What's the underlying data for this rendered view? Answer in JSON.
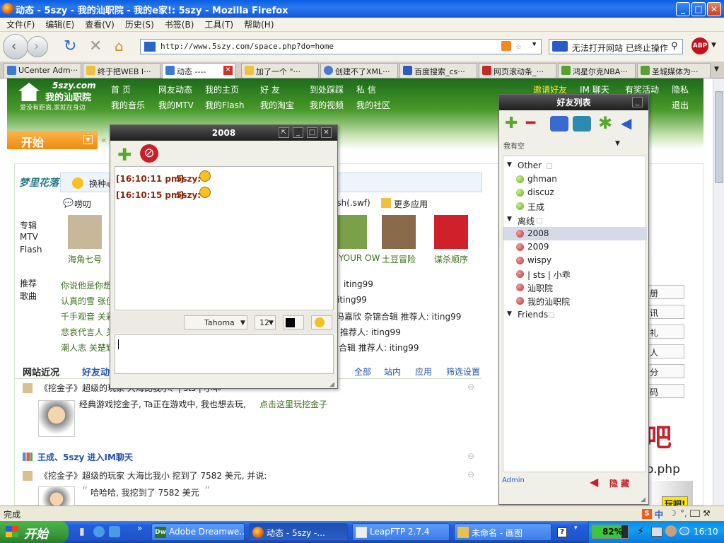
{
  "window": {
    "title": "动态 - 5szy - 我的汕职院 - 我的e家!: 5szy - Mozilla Firefox"
  },
  "menu": [
    "文件(F)",
    "编辑(E)",
    "查看(V)",
    "历史(S)",
    "书签(B)",
    "工具(T)",
    "帮助(H)"
  ],
  "address": {
    "url": "http://www.5szy.com/space.php?do=home"
  },
  "search": {
    "value": "无法打开网站 已终止操作"
  },
  "tabs": [
    "UCenter Adm···",
    "终于把WEB I···",
    "动态 ----",
    "加了一个 \"···",
    "创建不了XML···",
    "百度搜索_cs···",
    "网页滚动条_···",
    "鸿星尔克NBA···",
    "圣城媒体为···"
  ],
  "site": {
    "logo_top": "5szy.com",
    "logo_name": "我的汕职院",
    "logo_slogan": "爱没有距离,家就在身边",
    "nav_row1": [
      "首  页",
      "网友动态",
      "我的主页",
      "好  友",
      "到处踩踩",
      "私  信"
    ],
    "nav_row2": [
      "我的音乐",
      "我的MTV",
      "我的Flash",
      "我的淘宝",
      "我的视频",
      "我的社区"
    ],
    "right_row1": [
      "邀请好友",
      "IM 聊天",
      "有奖活动",
      "隐私"
    ],
    "right_row2": [
      "退出"
    ],
    "start": "开始",
    "side_brand": "梦里花落",
    "mood_text": "换种心",
    "chat_link": "唠叨",
    "swf_text": "ash(.swf)",
    "more_apps": "更多应用",
    "left_labels": [
      "专辑",
      "MTV",
      "Flash"
    ],
    "left_labels2": [
      "推荐",
      "歌曲"
    ],
    "albums": [
      {
        "name": "海角七号",
        "color": "#c8b89a"
      },
      {
        "name": "YOUR OW",
        "color": "#7aa04a"
      },
      {
        "name": "土豆冒险",
        "color": "#8a6a4a"
      },
      {
        "name": "谋杀顺序",
        "color": "#d0202a"
      }
    ],
    "songs_left": [
      "你说他是你想",
      "认真的雪 张佳",
      "千手观音 关彩",
      "悲哀代言人 关",
      "潮人志 关楚耀"
    ],
    "songs_right": [
      "iting99",
      "iting99",
      "冯嘉欣 杂锦合辑 推荐人: iting99",
      "推荐人: iting99",
      "合辑 推荐人: iting99"
    ],
    "section_title": "网站近况",
    "section_tab2": "好友动",
    "filters": [
      "全部",
      "站内",
      "应用",
      "筛选设置"
    ],
    "feed1_text": "《挖金子》超级的玩家 大海比我小、| sts | 小乖",
    "feed1_detail": "经典游戏挖金子, Ta正在游戏中, 我也想去玩,",
    "feed1_link": "点击这里玩挖金子",
    "feed2_text": "王成、5szy 进入IM聊天",
    "feed3_text": "《挖金子》超级的玩家 大海比我小 挖到了 7582 美元, 并说:",
    "feed3_quote": "哈哈哈, 我挖到了 7582 美元",
    "right_buttons": [
      "册",
      "讯",
      "礼",
      "人",
      "分",
      "码"
    ],
    "right_promo": "吧",
    "right_php": "o.php",
    "right_play": "玩吧!"
  },
  "chat": {
    "title": "2008",
    "messages": [
      {
        "time": "[16:10:11 pm]",
        "user": "5szy:"
      },
      {
        "time": "[16:10:15 pm]",
        "user": "5szy:"
      }
    ],
    "font": "Tahoma",
    "size": "12"
  },
  "friends": {
    "title": "好友列表",
    "status": "我有空",
    "footer_user": "Admin",
    "hide_label": "隐 藏",
    "groups": [
      {
        "name": "Other",
        "members": [
          "ghman",
          "discuz",
          "王成"
        ],
        "online": true
      },
      {
        "name": "离线",
        "members": [
          "2008",
          "2009",
          "wispy",
          "| sts | 小乖",
          "汕职院",
          "我的汕职院"
        ],
        "online": false
      },
      {
        "name": "Friends",
        "members": [],
        "online": true
      }
    ]
  },
  "statusbar": {
    "text": "完成"
  },
  "taskbar": {
    "start": "开始",
    "items": [
      "Adobe Dreamwe...",
      "动态 - 5szy -...",
      "LeapFTP 2.7.4",
      "未命名 - 画图"
    ],
    "zoom": "82%",
    "time": "16:10"
  }
}
